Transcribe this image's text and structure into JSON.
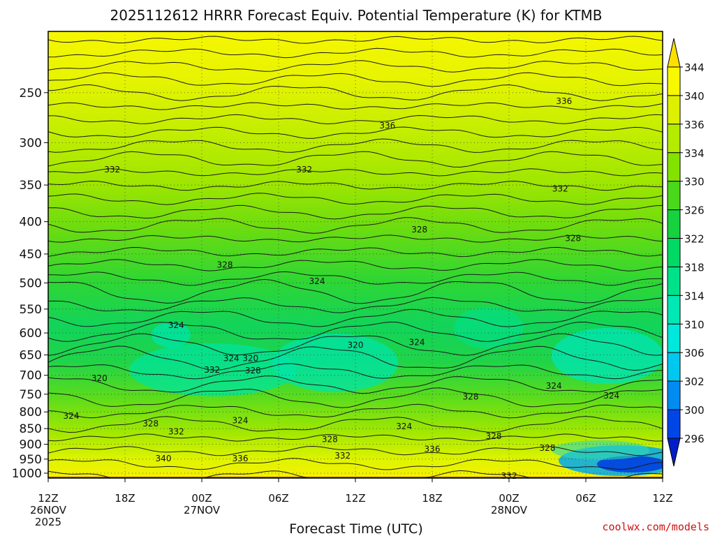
{
  "chart_data": {
    "type": "heatmap",
    "title": "2025112612 HRRR Forecast Equiv. Potential Temperature (K) for KTMB",
    "xlabel": "Forecast Time (UTC)",
    "ylabel": "",
    "x_axis": {
      "unit": "forecast hour",
      "xlim": [
        0,
        48
      ],
      "ticks": [
        {
          "x": 0,
          "label": "12Z",
          "sub1": "26NOV",
          "sub2": "2025"
        },
        {
          "x": 6,
          "label": "18Z",
          "sub1": "",
          "sub2": ""
        },
        {
          "x": 12,
          "label": "00Z",
          "sub1": "27NOV",
          "sub2": ""
        },
        {
          "x": 18,
          "label": "06Z",
          "sub1": "",
          "sub2": ""
        },
        {
          "x": 24,
          "label": "12Z",
          "sub1": "",
          "sub2": ""
        },
        {
          "x": 30,
          "label": "18Z",
          "sub1": "",
          "sub2": ""
        },
        {
          "x": 36,
          "label": "00Z",
          "sub1": "28NOV",
          "sub2": ""
        },
        {
          "x": 42,
          "label": "06Z",
          "sub1": "",
          "sub2": ""
        },
        {
          "x": 48,
          "label": "12Z",
          "sub1": "",
          "sub2": ""
        }
      ]
    },
    "y_axis": {
      "unit": "hPa",
      "scale": "log",
      "reversed": true,
      "ylim": [
        1018,
        200
      ],
      "ticks": [
        "250",
        "300",
        "350",
        "400",
        "450",
        "500",
        "550",
        "600",
        "650",
        "700",
        "750",
        "800",
        "850",
        "900",
        "950",
        "1000"
      ]
    },
    "grid": true,
    "colorbar": {
      "placement": "right",
      "labels": [
        "344",
        "340",
        "336",
        "334",
        "330",
        "326",
        "322",
        "318",
        "314",
        "310",
        "306",
        "302",
        "300",
        "296"
      ],
      "colors": [
        "#fde000",
        "#f8f800",
        "#dcf000",
        "#b4ec00",
        "#84e200",
        "#4ad81a",
        "#16d23e",
        "#00d964",
        "#00e28a",
        "#00e8b4",
        "#00e8dc",
        "#00c8f0",
        "#008cf0",
        "#0046e6",
        "#001ec8"
      ]
    },
    "contour_labels": [
      {
        "x": 40.3,
        "p": 258,
        "value": "336"
      },
      {
        "x": 26.5,
        "p": 282,
        "value": "336"
      },
      {
        "x": 5.0,
        "p": 331,
        "value": "332"
      },
      {
        "x": 20.0,
        "p": 331,
        "value": "332"
      },
      {
        "x": 40.0,
        "p": 355,
        "value": "332"
      },
      {
        "x": 29.0,
        "p": 412,
        "value": "328"
      },
      {
        "x": 13.8,
        "p": 468,
        "value": "328"
      },
      {
        "x": 41.0,
        "p": 425,
        "value": "328"
      },
      {
        "x": 21.0,
        "p": 497,
        "value": "324"
      },
      {
        "x": 10.0,
        "p": 583,
        "value": "324"
      },
      {
        "x": 24.0,
        "p": 627,
        "value": "320"
      },
      {
        "x": 28.8,
        "p": 621,
        "value": "324"
      },
      {
        "x": 14.3,
        "p": 658,
        "value": "324"
      },
      {
        "x": 15.8,
        "p": 658,
        "value": "320"
      },
      {
        "x": 4.0,
        "p": 708,
        "value": "320"
      },
      {
        "x": 12.8,
        "p": 686,
        "value": "332"
      },
      {
        "x": 16.0,
        "p": 688,
        "value": "328"
      },
      {
        "x": 33.0,
        "p": 757,
        "value": "328"
      },
      {
        "x": 39.5,
        "p": 728,
        "value": "324"
      },
      {
        "x": 44.0,
        "p": 754,
        "value": "324"
      },
      {
        "x": 1.8,
        "p": 812,
        "value": "324"
      },
      {
        "x": 8.0,
        "p": 835,
        "value": "328"
      },
      {
        "x": 10.0,
        "p": 860,
        "value": "332"
      },
      {
        "x": 15.0,
        "p": 825,
        "value": "324"
      },
      {
        "x": 27.8,
        "p": 843,
        "value": "324"
      },
      {
        "x": 22.0,
        "p": 884,
        "value": "328"
      },
      {
        "x": 34.8,
        "p": 874,
        "value": "328"
      },
      {
        "x": 30.0,
        "p": 916,
        "value": "336"
      },
      {
        "x": 39.0,
        "p": 913,
        "value": "328"
      },
      {
        "x": 23.0,
        "p": 938,
        "value": "332"
      },
      {
        "x": 9.0,
        "p": 948,
        "value": "340"
      },
      {
        "x": 15.0,
        "p": 948,
        "value": "336"
      },
      {
        "x": 36.0,
        "p": 1010,
        "value": "332"
      }
    ]
  },
  "credit": "coolwx.com/models"
}
